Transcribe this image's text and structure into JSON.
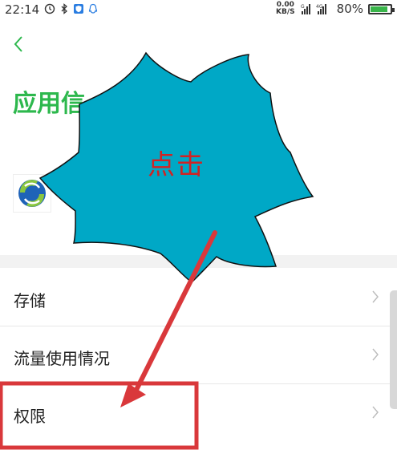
{
  "status_bar": {
    "time": "22:14",
    "speed_value": "0.00",
    "speed_unit": "KB/S",
    "battery": "80%",
    "battery_level": 0.8
  },
  "header": {
    "title": "应用信"
  },
  "list": [
    {
      "label": "存储"
    },
    {
      "label": "流量使用情况"
    },
    {
      "label": "权限"
    }
  ],
  "annotation": {
    "callout_text": "点击",
    "star_color": "#00a8c6",
    "highlight_color": "#d9383b",
    "arrow_color": "#d9383b"
  },
  "colors": {
    "accent": "#2db84d"
  },
  "icons": [
    "alarm-icon",
    "bluetooth-icon",
    "shield-icon",
    "qq-icon",
    "signal-icon",
    "battery-icon",
    "back-chevron-icon",
    "chevron-right-icon"
  ]
}
